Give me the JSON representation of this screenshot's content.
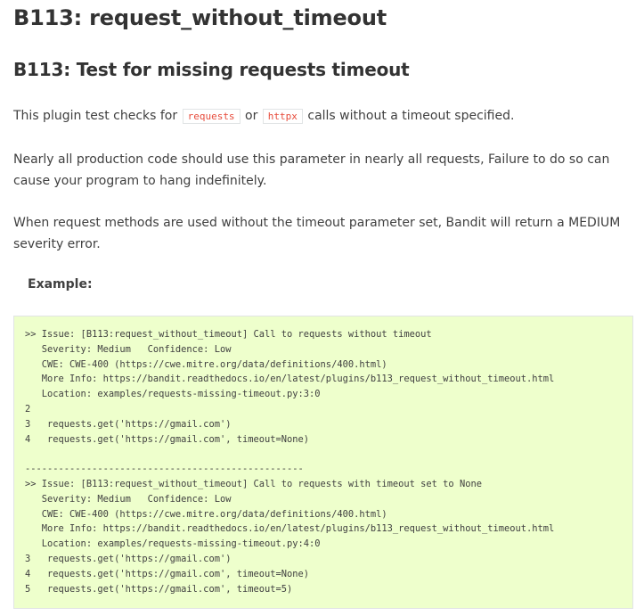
{
  "title": "B113: request_without_timeout",
  "subtitle": "B113: Test for missing requests timeout",
  "intro": {
    "before": "This plugin test checks for ",
    "code1": "requests",
    "middle": " or ",
    "code2": "httpx",
    "after": " calls without a timeout specified."
  },
  "paragraph2": "Nearly all production code should use this parameter in nearly all requests, Failure to do so can cause your program to hang indefinitely.",
  "paragraph3": "When request methods are used without the timeout parameter set, Bandit will return a MEDIUM severity error.",
  "example_label": "Example:",
  "code_lines": [
    ">> Issue: [B113:request_without_timeout] Call to requests without timeout",
    "   Severity: Medium   Confidence: Low",
    "   CWE: CWE-400 (https://cwe.mitre.org/data/definitions/400.html)",
    "   More Info: https://bandit.readthedocs.io/en/latest/plugins/b113_request_without_timeout.html",
    "   Location: examples/requests-missing-timeout.py:3:0",
    "2",
    "3   requests.get('https://gmail.com')",
    "4   requests.get('https://gmail.com', timeout=None)",
    "",
    "--------------------------------------------------",
    ">> Issue: [B113:request_without_timeout] Call to requests with timeout set to None",
    "   Severity: Medium   Confidence: Low",
    "   CWE: CWE-400 (https://cwe.mitre.org/data/definitions/400.html)",
    "   More Info: https://bandit.readthedocs.io/en/latest/plugins/b113_request_without_timeout.html",
    "   Location: examples/requests-missing-timeout.py:4:0",
    "3   requests.get('https://gmail.com')",
    "4   requests.get('https://gmail.com', timeout=None)",
    "5   requests.get('https://gmail.com', timeout=5)"
  ]
}
